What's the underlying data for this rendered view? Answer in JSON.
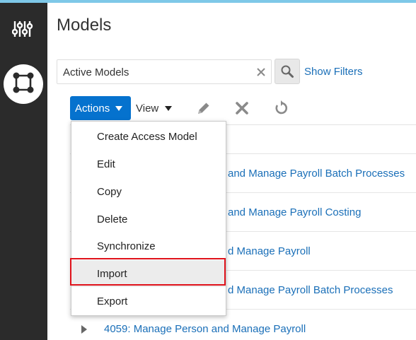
{
  "colors": {
    "accent": "#0572ce",
    "link": "#1a6fb8",
    "sidebar": "#2b2b2b",
    "highlight_border": "#e0131c",
    "top_strip": "#7ec8e8"
  },
  "sidebar": {
    "items": [
      {
        "icon": "filter-sliders-icon",
        "active": false
      },
      {
        "icon": "access-model-icon",
        "active": true
      }
    ]
  },
  "page": {
    "title": "Models"
  },
  "search": {
    "value": "Active Models",
    "clear_icon": "close-icon",
    "search_icon": "search-icon",
    "show_filters_label": "Show Filters"
  },
  "toolbar": {
    "actions_label": "Actions",
    "view_label": "View",
    "icons": [
      "edit-pencil-icon",
      "delete-x-icon",
      "refresh-icon"
    ]
  },
  "actions_menu": {
    "items": [
      {
        "label": "Create Access Model"
      },
      {
        "label": "Edit"
      },
      {
        "label": "Copy"
      },
      {
        "label": "Delete"
      },
      {
        "label": "Synchronize"
      },
      {
        "label": "Import",
        "highlighted": true
      },
      {
        "label": "Export"
      }
    ]
  },
  "table": {
    "rows": [
      {
        "visible_text": "and Manage Payroll Batch Processes"
      },
      {
        "visible_text": "and Manage Payroll Costing"
      },
      {
        "visible_text": "d Manage Payroll"
      },
      {
        "visible_text": "d Manage Payroll Batch Processes"
      },
      {
        "visible_text": "4059: Manage Person and Manage Payroll"
      }
    ]
  }
}
